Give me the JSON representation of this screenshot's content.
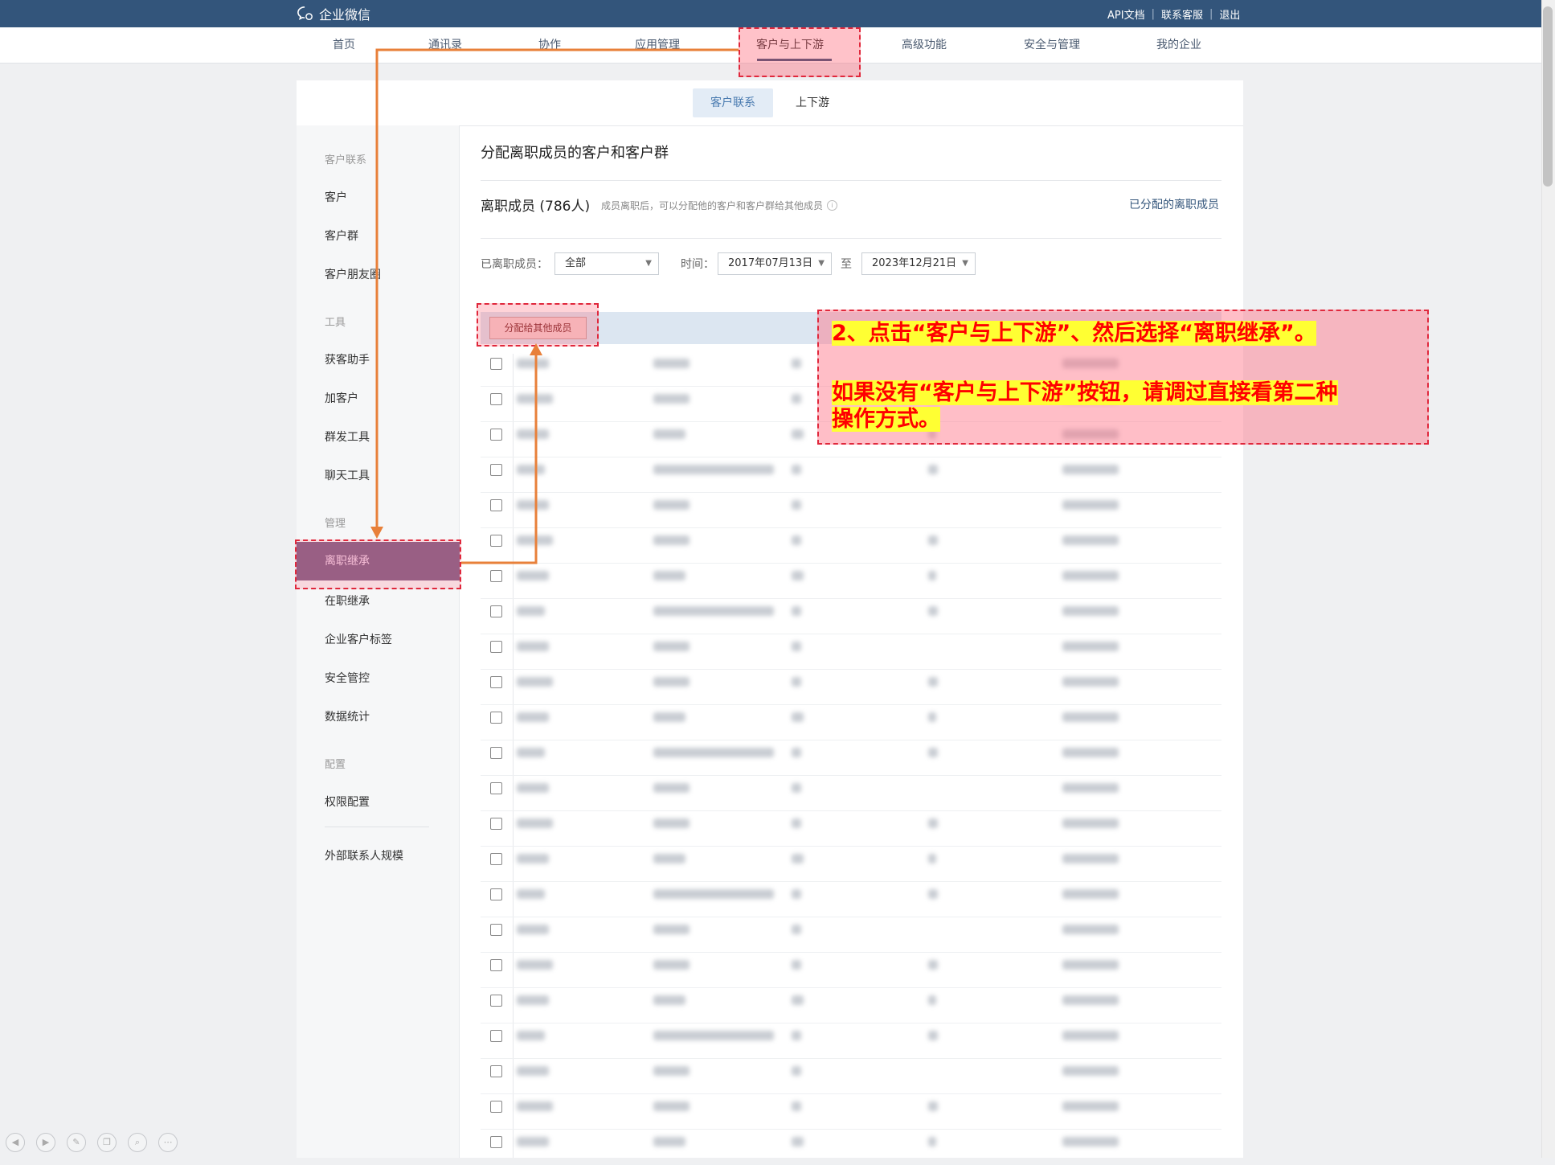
{
  "app": {
    "logo_text": "企业微信"
  },
  "top_links": [
    "API文档",
    "联系客服",
    "退出"
  ],
  "nav": {
    "items": [
      "首页",
      "通讯录",
      "协作",
      "应用管理",
      "客户与上下游",
      "高级功能",
      "安全与管理",
      "我的企业"
    ],
    "active": "客户与上下游"
  },
  "subtabs": [
    "客户联系",
    "上下游"
  ],
  "sidebar": {
    "group_customer": "客户联系",
    "items_customer": [
      "客户",
      "客户群",
      "客户朋友圈"
    ],
    "group_tools": "工具",
    "items_tools": [
      "获客助手",
      "加客户",
      "群发工具",
      "聊天工具"
    ],
    "group_manage": "管理",
    "active_item": "离职继承",
    "items_manage": [
      "在职继承",
      "企业客户标签",
      "安全管控",
      "数据统计"
    ],
    "group_config": "配置",
    "items_config": [
      "权限配置"
    ],
    "extra": "外部联系人规模"
  },
  "main": {
    "title": "分配离职成员的客户和客户群",
    "count_label": "离职成员 (786人)",
    "count_hint": "成员离职后，可以分配他的客户和客户群给其他成员",
    "assigned_link": "已分配的离职成员",
    "filter": {
      "member_label": "已离职成员：",
      "member_value": "全部",
      "time_label": "时间：",
      "from": "2017年07月13日",
      "to_label": "至",
      "to": "2023年12月21日"
    },
    "assign_button": "分配给其他成员",
    "row_count": 23
  },
  "annotation": {
    "line1": "2、点击“客户与上下游”、然后选择“离职继承”。",
    "line2": "如果没有“客户与上下游”按钮，请调过直接看第二种",
    "line3": "操作方式。"
  },
  "colors": {
    "topbar": "#33557b",
    "active_sidebar": "#7d5b84",
    "annotation_text": "#ff0000",
    "annotation_highlight": "#ffff33",
    "arrow": "#e8803a"
  },
  "icons": [
    "wechat-work-logo-icon",
    "info-icon",
    "chevron-down-icon",
    "checkbox-icon",
    "prev-icon",
    "next-icon",
    "pen-icon",
    "copy-icon",
    "zoom-icon",
    "more-icon"
  ]
}
